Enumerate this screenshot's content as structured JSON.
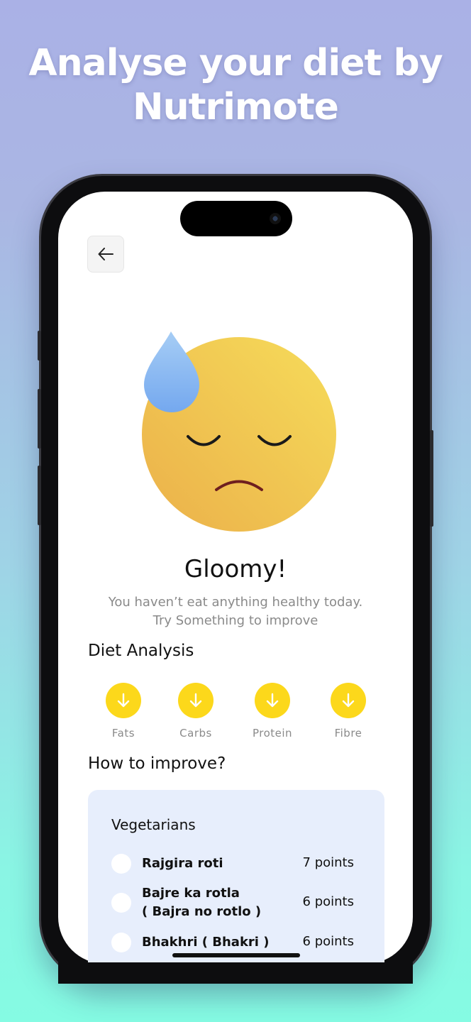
{
  "headline": {
    "line1": "Analyse your diet by",
    "line2": "Nutrimote"
  },
  "header": {
    "back_icon": "arrow-left-icon"
  },
  "mood": {
    "emoji": "downcast-face-with-sweat-icon",
    "title": "Gloomy!",
    "description": "You haven’t eat anything healthy today. Try Something to improve"
  },
  "diet_analysis": {
    "title": "Diet Analysis",
    "items": [
      {
        "label": "Fats",
        "icon": "arrow-down-icon"
      },
      {
        "label": "Carbs",
        "icon": "arrow-down-icon"
      },
      {
        "label": "Protein",
        "icon": "arrow-down-icon"
      },
      {
        "label": "Fibre",
        "icon": "arrow-down-icon"
      }
    ]
  },
  "improve": {
    "title": "How to improve?",
    "card_title": "Vegetarians",
    "foods": [
      {
        "name_line1": "Rajgira roti",
        "name_line2": "",
        "points": "7 points"
      },
      {
        "name_line1": "Bajre ka rotla",
        "name_line2": "( Bajra no rotlo )",
        "points": "6 points"
      },
      {
        "name_line1": "Bhakhri ( Bhakri )",
        "name_line2": "",
        "points": "6 points"
      }
    ]
  },
  "colors": {
    "accent_yellow": "#fcd81b",
    "card_bg": "#e7eefc",
    "muted_text": "#8a8a8a"
  }
}
